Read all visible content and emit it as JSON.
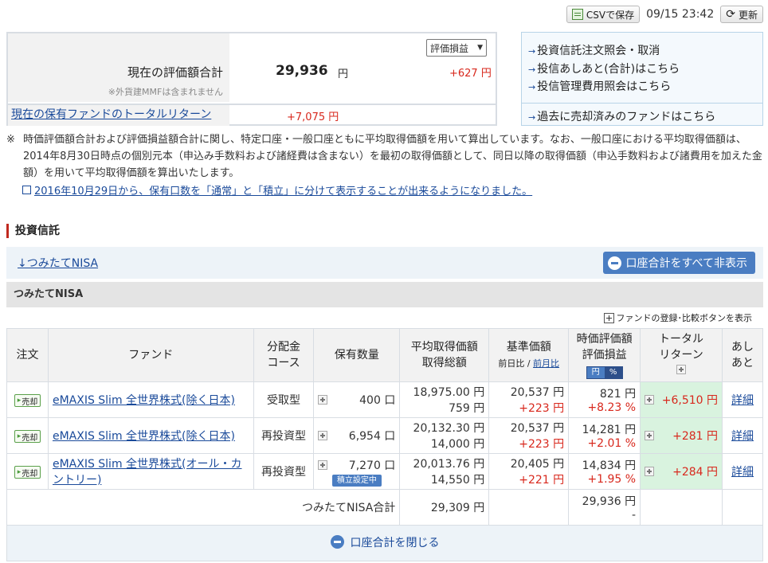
{
  "toolbar": {
    "csv_label": "CSVで保存",
    "datetime": "09/15 23:42",
    "refresh_label": "更新"
  },
  "summary": {
    "valuation_label": "現在の評価額合計",
    "valuation_note": "※外貨建MMFは含まれません",
    "valuation_value": "29,936",
    "valuation_unit": "円",
    "gain_value": "+627 円",
    "select_value": "評価損益",
    "total_return_label": "現在の保有ファンドのトータルリターン",
    "total_return_value": "+7,075 円"
  },
  "links_panel": {
    "items": [
      "投資信託注文照会・取消",
      "投信あしあと(合計)はこちら",
      "投信管理費用照会はこちら"
    ],
    "past_funds": "過去に売却済みのファンドはこちら"
  },
  "notes": {
    "mark": "※",
    "text": "時価評価額合計および評価損益額合計に関し、特定口座・一般口座ともに平均取得価額を用いて算出しています。なお、一般口座における平均取得価額は、2014年8月30日時点の個別元本（申込み手数料および諸経費は含まない）を最初の取得価額として、同日以降の取得価額（申込手数料および諸費用を加えた金額）を用いて平均取得価額を算出いたします。",
    "link": "2016年10月29日から、保有口数を「通常」と「積立」に分けて表示することが出来るようになりました。"
  },
  "section": {
    "title": "投資信託",
    "nisa_link": "↓つみたてNISA",
    "hide_totals_button": "口座合計をすべて非表示",
    "nisa_header": "つみたてNISA",
    "fund_register": "ファンドの登録･比較ボタンを表示"
  },
  "table": {
    "headers": {
      "order": "注文",
      "fund": "ファンド",
      "dist_1": "分配金",
      "dist_2": "コース",
      "holdings": "保有数量",
      "avg_1": "平均取得価額",
      "avg_2": "取得総額",
      "base_1": "基準価額",
      "base_sub_a": "前日比",
      "base_sub_sep": " / ",
      "base_sub_b": "前月比",
      "val_1": "時価評価額",
      "val_2": "評価損益",
      "toggle_yen": "円",
      "toggle_pct": "%",
      "tr_1": "トータル",
      "tr_2": "リターン",
      "ash_1": "あし",
      "ash_2": "あと"
    },
    "rows": [
      {
        "sell": "売却",
        "fund": "eMAXIS Slim 全世界株式(除く日本)",
        "course": "受取型",
        "qty": "400 口",
        "reserve": "",
        "avg_price": "18,975.00 円",
        "avg_total": "759 円",
        "base": "20,537 円",
        "base_diff": "+223 円",
        "val": "821 円",
        "val_pct": "+8.23 %",
        "tr": "+6,510 円",
        "detail": "詳細"
      },
      {
        "sell": "売却",
        "fund": "eMAXIS Slim 全世界株式(除く日本)",
        "course": "再投資型",
        "qty": "6,954 口",
        "reserve": "",
        "avg_price": "20,132.30 円",
        "avg_total": "14,000 円",
        "base": "20,537 円",
        "base_diff": "+223 円",
        "val": "14,281 円",
        "val_pct": "+2.01 %",
        "tr": "+281 円",
        "detail": "詳細"
      },
      {
        "sell": "売却",
        "fund": "eMAXIS Slim 全世界株式(オール・カントリー)",
        "course": "再投資型",
        "qty": "7,270 口",
        "reserve": "積立設定中",
        "avg_price": "20,013.76 円",
        "avg_total": "14,550 円",
        "base": "20,405 円",
        "base_diff": "+221 円",
        "val": "14,834 円",
        "val_pct": "+1.95 %",
        "tr": "+284 円",
        "detail": "詳細"
      }
    ],
    "total": {
      "label": "つみたてNISA合計",
      "avg_total": "29,309 円",
      "val": "29,936 円",
      "val_diff": "-"
    },
    "close_label": "口座合計を閉じる"
  }
}
